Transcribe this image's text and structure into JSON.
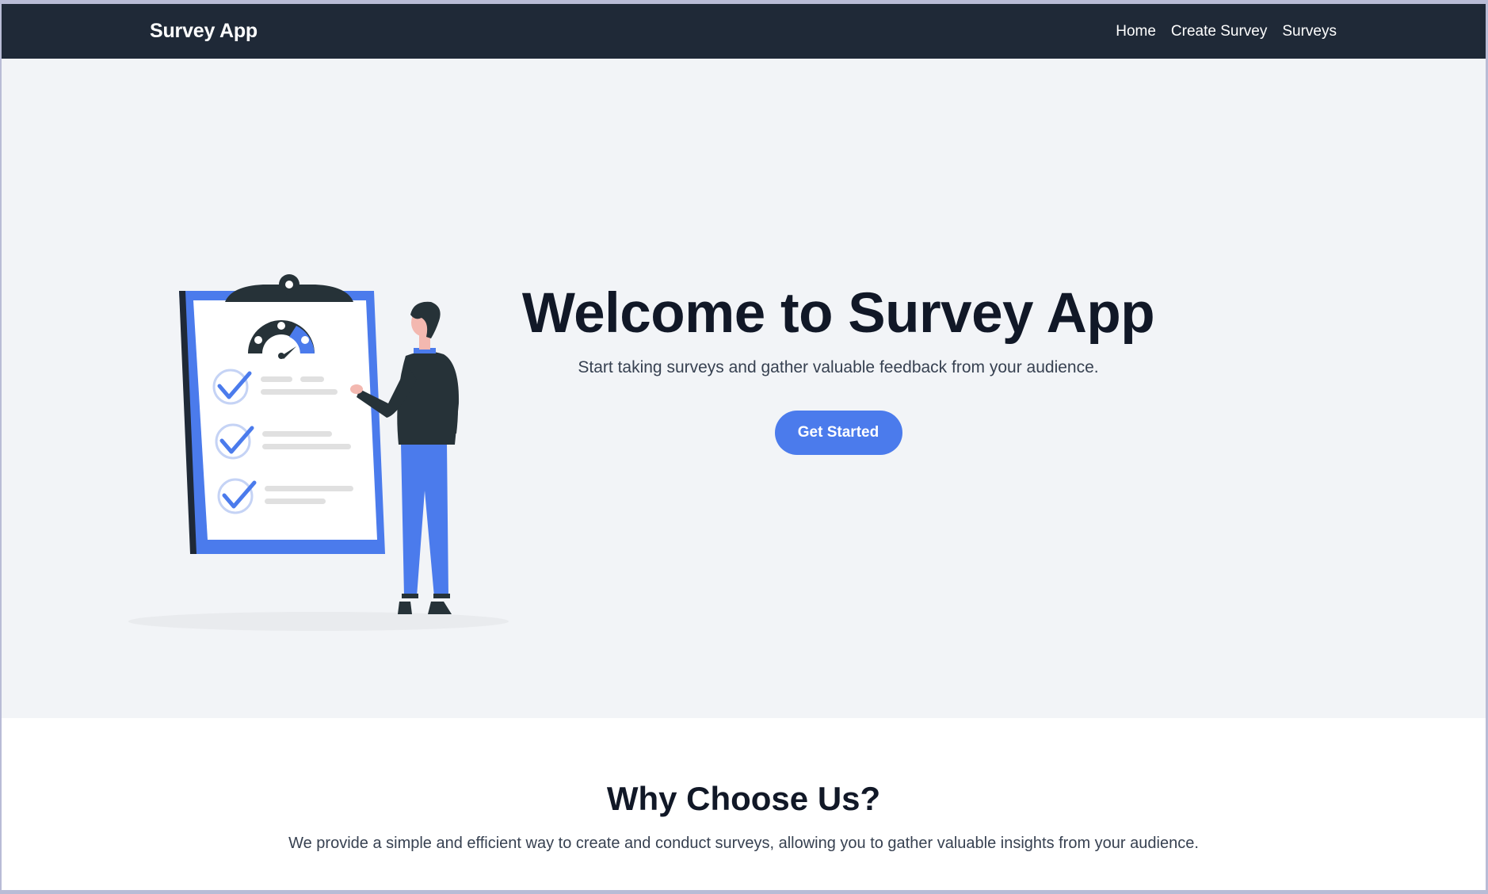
{
  "navbar": {
    "brand": "Survey App",
    "links": [
      "Home",
      "Create Survey",
      "Surveys"
    ]
  },
  "hero": {
    "title": "Welcome to Survey App",
    "subtitle": "Start taking surveys and gather valuable feedback from your audience.",
    "cta_label": "Get Started",
    "illustration": "clipboard-survey-illustration"
  },
  "features": {
    "title": "Why Choose Us?",
    "text": "We provide a simple and efficient way to create and conduct surveys, allowing you to gather valuable insights from your audience."
  },
  "colors": {
    "navbar_bg": "#1f2937",
    "hero_bg": "#f2f4f7",
    "accent": "#4b7bec",
    "heading": "#111827"
  }
}
